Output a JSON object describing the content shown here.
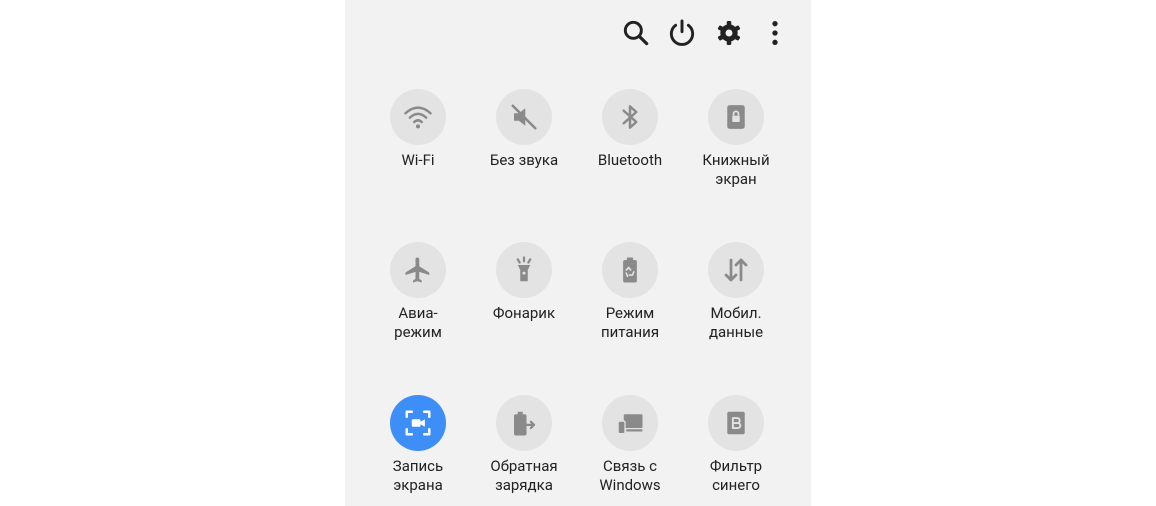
{
  "top_bar": {
    "icons": [
      "search-icon",
      "power-icon",
      "settings-icon",
      "more-options-icon"
    ]
  },
  "tiles": [
    {
      "label": "Wi-Fi",
      "icon": "wifi-icon",
      "active": false
    },
    {
      "label": "Без звука",
      "icon": "mute-icon",
      "active": false
    },
    {
      "label": "Bluetooth",
      "icon": "bluetooth-icon",
      "active": false
    },
    {
      "label": "Книжный\nэкран",
      "icon": "portrait-lock-icon",
      "active": false
    },
    {
      "label": "Авиа-\nрежим",
      "icon": "airplane-icon",
      "active": false
    },
    {
      "label": "Фонарик",
      "icon": "flashlight-icon",
      "active": false
    },
    {
      "label": "Режим\nпитания",
      "icon": "power-mode-icon",
      "active": false
    },
    {
      "label": "Мобил.\nданные",
      "icon": "mobile-data-icon",
      "active": false
    },
    {
      "label": "Запись\nэкрана",
      "icon": "screen-record-icon",
      "active": true
    },
    {
      "label": "Обратная\nзарядка",
      "icon": "reverse-charging-icon",
      "active": false
    },
    {
      "label": "Связь с\nWindows",
      "icon": "link-to-windows-icon",
      "active": false
    },
    {
      "label": "Фильтр\nсинего",
      "icon": "blue-light-filter-icon",
      "active": false
    }
  ],
  "colors": {
    "panel": "#f2f2f2",
    "tile": "#e3e3e3",
    "active": "#3e8ef7",
    "icon": "#8a8a8a"
  }
}
